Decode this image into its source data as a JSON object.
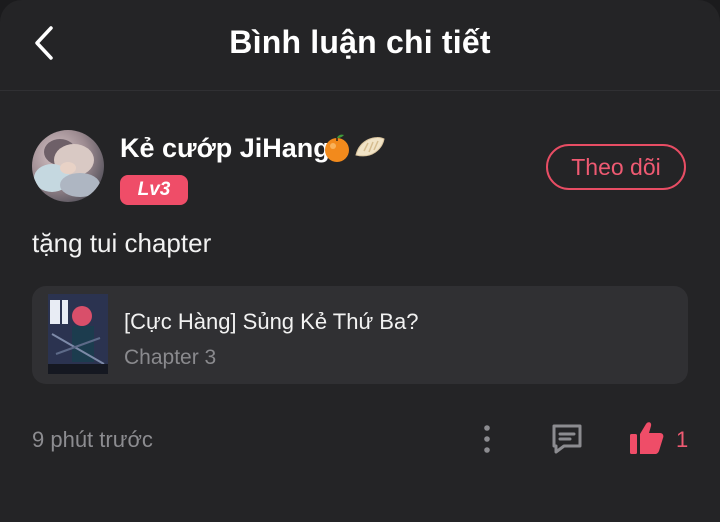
{
  "header": {
    "title": "Bình luận chi tiết",
    "back_icon": "chevron-left-icon"
  },
  "comment": {
    "username": "Kẻ cướp JiHang",
    "username_emojis": [
      "tangerine-emoji",
      "dumpling-emoji"
    ],
    "level": "Lv3",
    "follow_label": "Theo dõi",
    "text": "tặng tui chapter",
    "card": {
      "title": "[Cực Hàng] Sủng Kẻ Thứ Ba?",
      "subtitle": "Chapter 3"
    },
    "timestamp": "9 phút trước",
    "like_count": "1"
  },
  "colors": {
    "background": "#242426",
    "card": "#303033",
    "accent": "#ef4d68",
    "muted_text": "#8c8c90"
  }
}
